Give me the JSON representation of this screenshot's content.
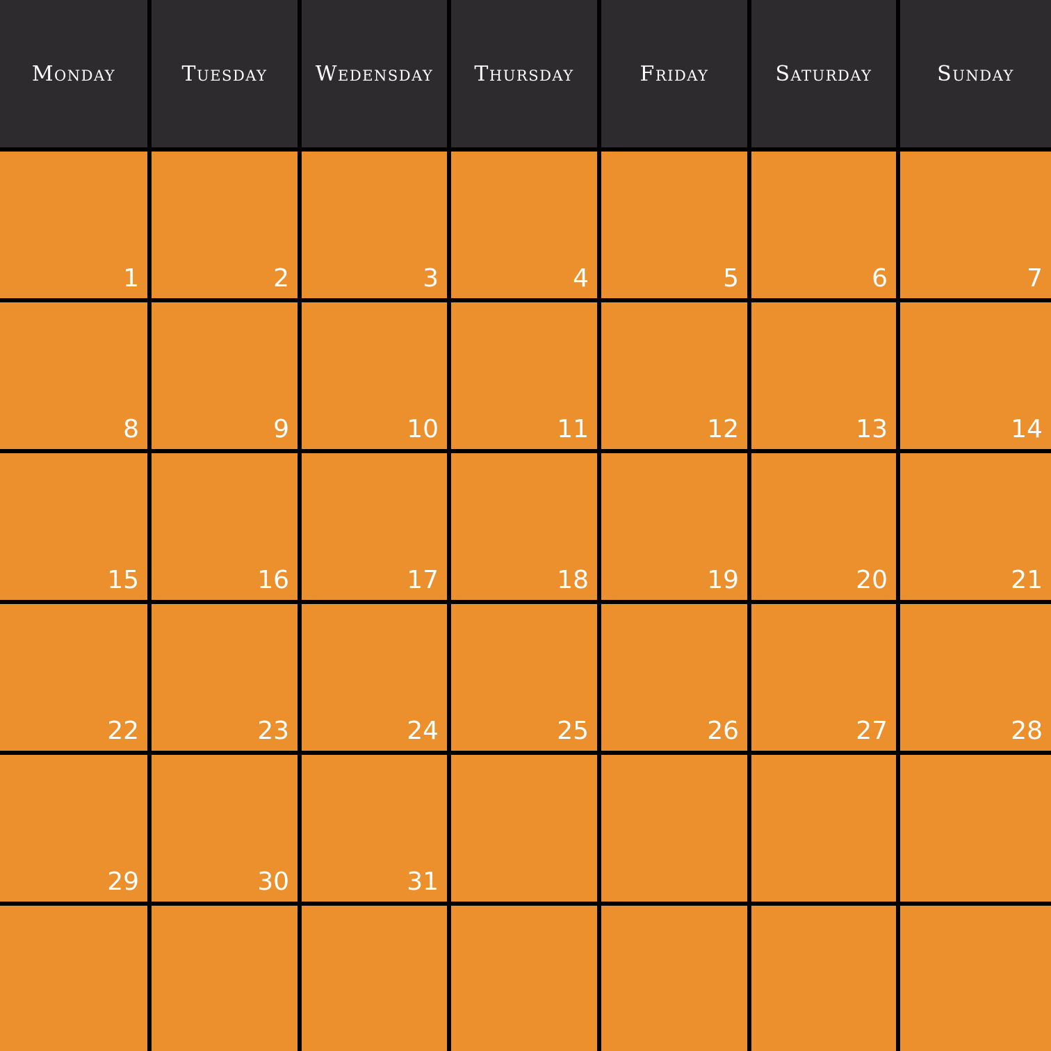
{
  "calendar": {
    "weekdays": [
      "Monday",
      "Tuesday",
      "Wedensday",
      "Thursday",
      "Friday",
      "Saturday",
      "Sunday"
    ],
    "weeks": [
      [
        "1",
        "2",
        "3",
        "4",
        "5",
        "6",
        "7"
      ],
      [
        "8",
        "9",
        "10",
        "11",
        "12",
        "13",
        "14"
      ],
      [
        "15",
        "16",
        "17",
        "18",
        "19",
        "20",
        "21"
      ],
      [
        "22",
        "23",
        "24",
        "25",
        "26",
        "27",
        "28"
      ],
      [
        "29",
        "30",
        "31",
        "",
        "",
        "",
        ""
      ],
      [
        "",
        "",
        "",
        "",
        "",
        "",
        ""
      ]
    ],
    "colors": {
      "background": "#000000",
      "header": "#2d2b2e",
      "day_cell": "#eb902d",
      "text": "#ffffff"
    }
  }
}
